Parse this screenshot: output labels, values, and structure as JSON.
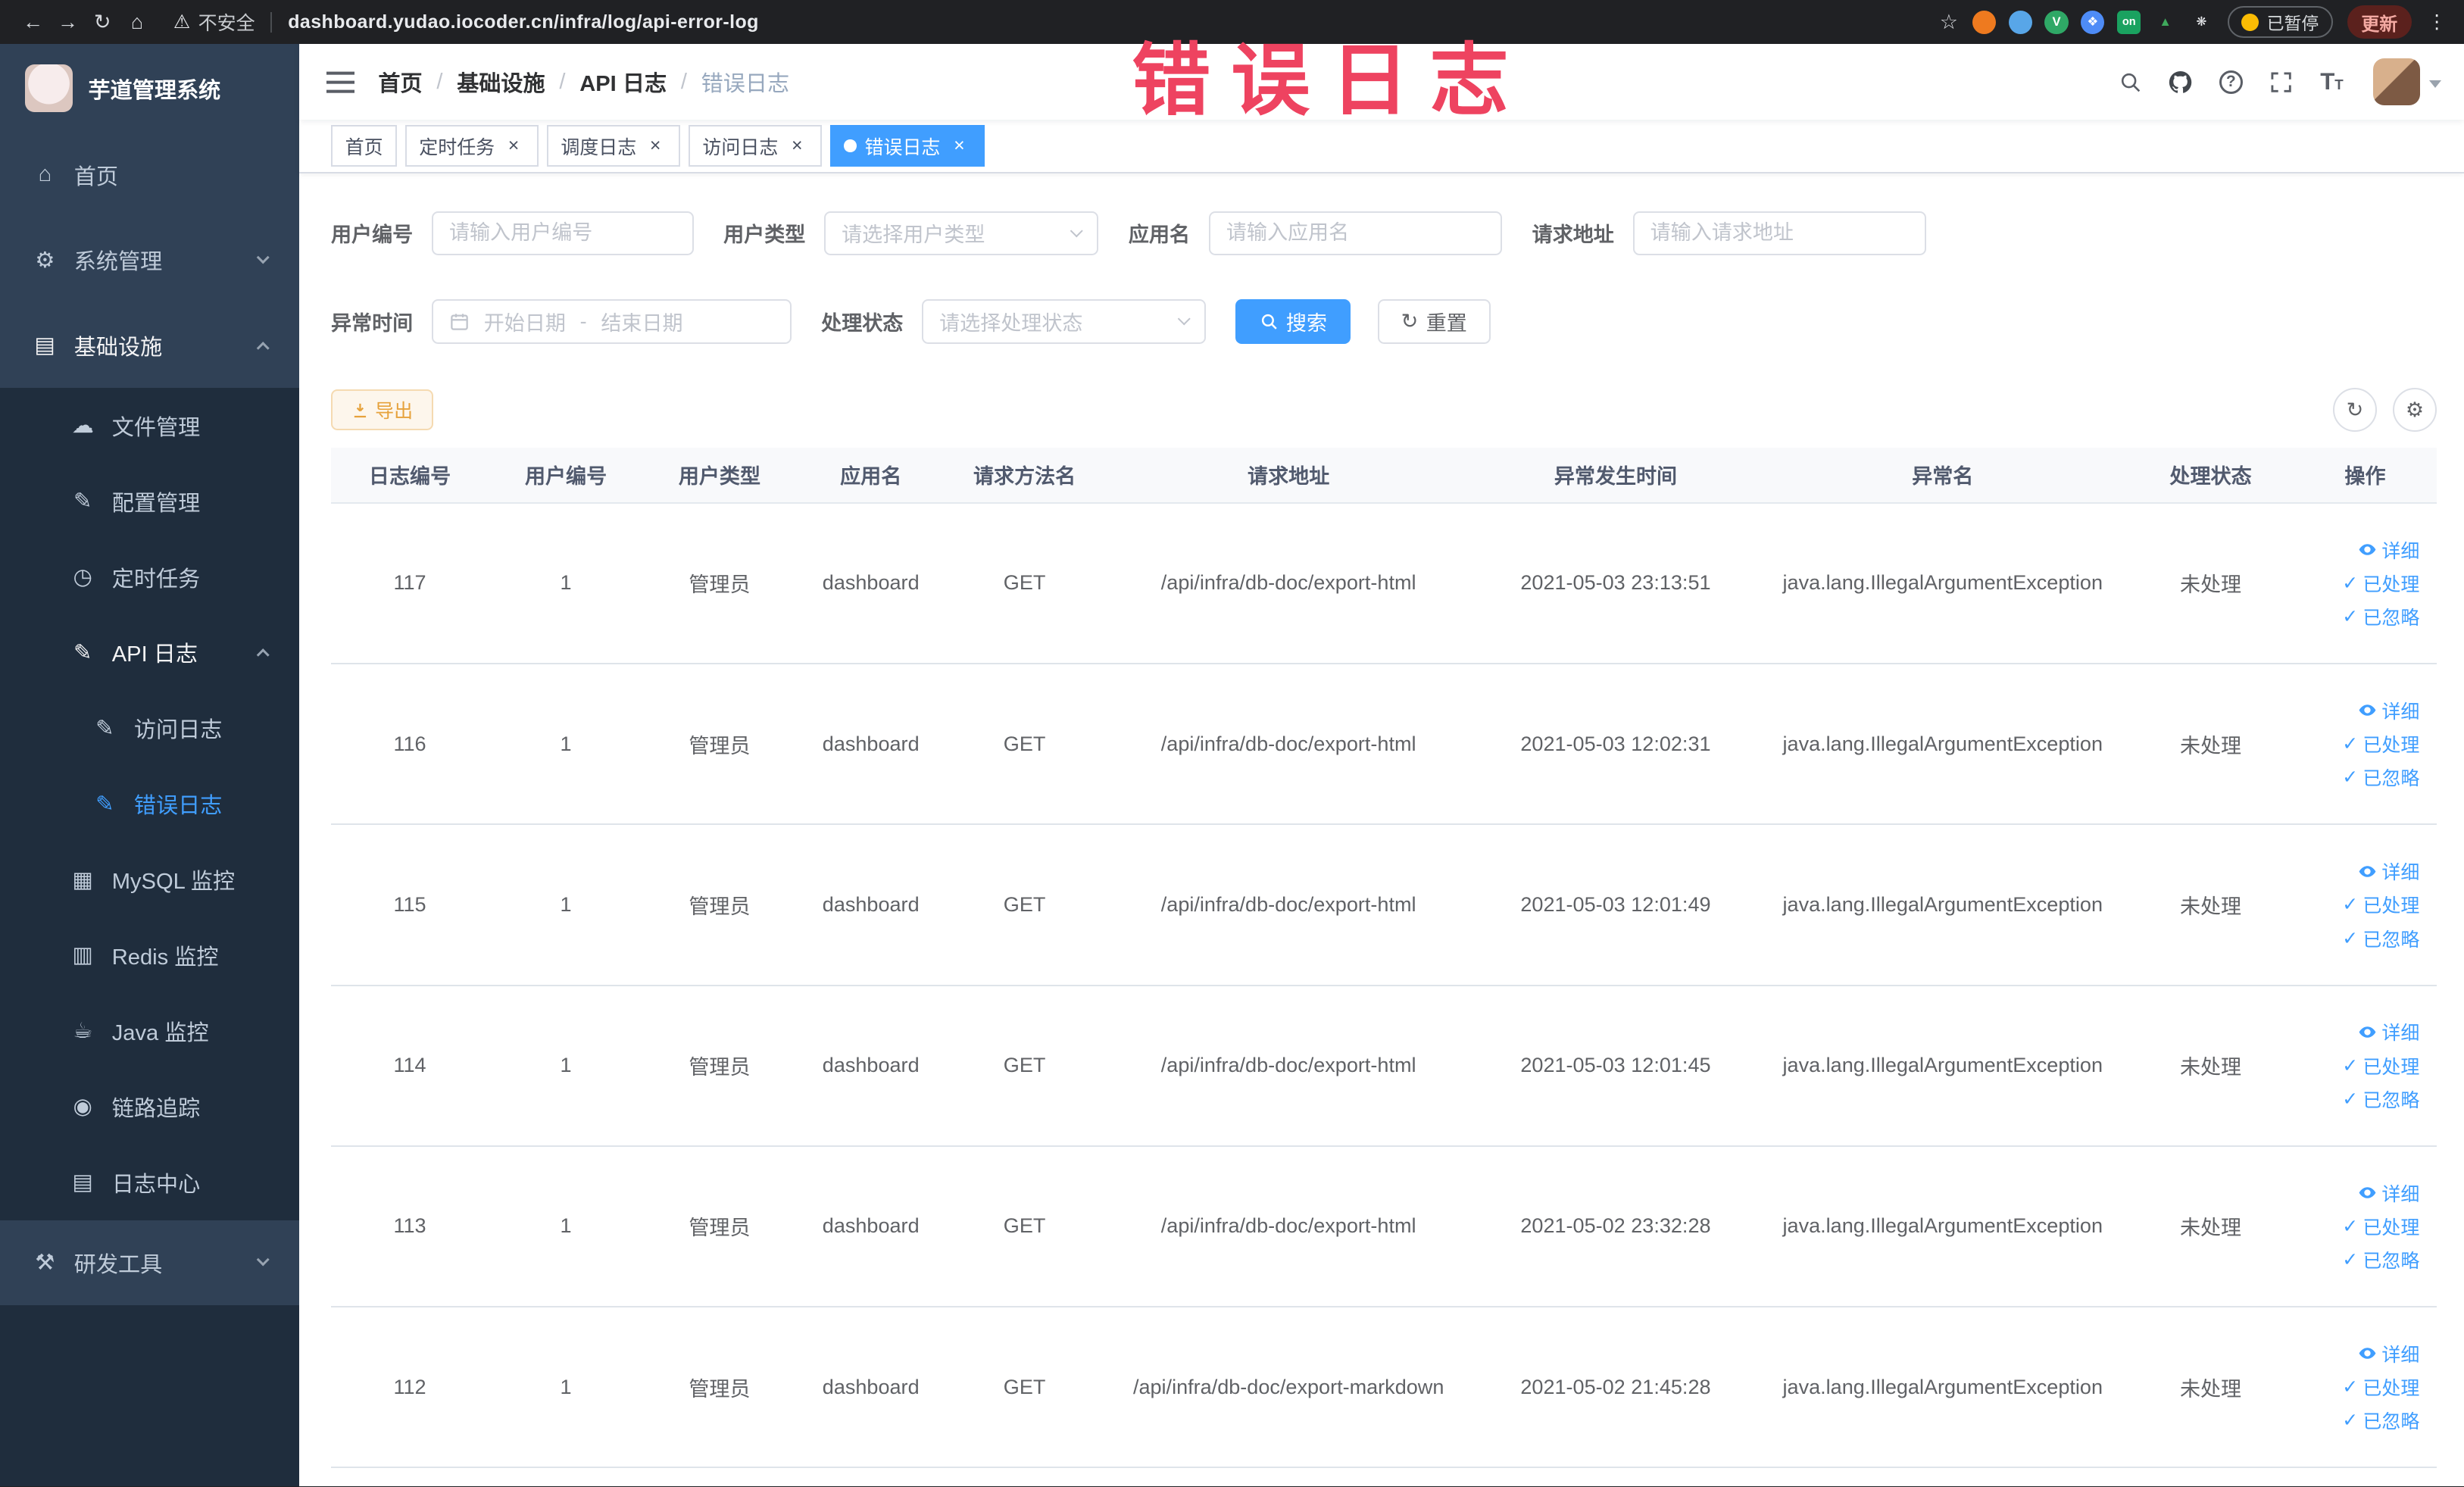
{
  "watermark": {
    "text": "错误日志"
  },
  "browser": {
    "security_label": "不安全",
    "url": "dashboard.yudao.iocoder.cn/infra/log/api-error-log",
    "paused_label": "已暂停",
    "update_label": "更新",
    "nav": {
      "back": "←",
      "forward": "→",
      "reload": "↻",
      "home": "⌂",
      "warning": "⚠",
      "star": "☆",
      "kebab": "⋮"
    },
    "extensions": [
      {
        "name": "extension-orange-icon",
        "color": "#ee7a1f",
        "glyph": "",
        "glyph_color": "#ffffff"
      },
      {
        "name": "extension-blue-icon",
        "color": "#58a6e8",
        "glyph": "",
        "glyph_color": "#ffffff"
      },
      {
        "name": "extension-green-v-icon",
        "color": "#2fa866",
        "glyph": "V",
        "glyph_color": "#ffffff"
      },
      {
        "name": "extension-blue-grid-icon",
        "color": "#4e8cf7",
        "glyph": "❖",
        "glyph_color": "#ffffff"
      },
      {
        "name": "extension-on-badge-icon",
        "color": "#1aa260",
        "glyph": "on",
        "glyph_color": "#ffffff"
      },
      {
        "name": "extension-tree-icon",
        "color": "transparent",
        "glyph": "▲",
        "glyph_color": "#3fa95c"
      },
      {
        "name": "extension-paw-icon",
        "color": "transparent",
        "glyph": "❋",
        "glyph_color": "#e8eaed"
      }
    ]
  },
  "sidebar": {
    "title": "芋道管理系统",
    "items": [
      {
        "key": "home",
        "label": "首页",
        "icon": "⌂",
        "type": "top"
      },
      {
        "key": "system",
        "label": "系统管理",
        "icon": "⚙",
        "type": "top",
        "chevron": "down"
      },
      {
        "key": "infra",
        "label": "基础设施",
        "icon": "▤",
        "type": "top",
        "chevron": "up",
        "parent": true
      },
      {
        "key": "file",
        "label": "文件管理",
        "icon": "☁",
        "type": "sub"
      },
      {
        "key": "config",
        "label": "配置管理",
        "icon": "✎",
        "type": "sub"
      },
      {
        "key": "job",
        "label": "定时任务",
        "icon": "◷",
        "type": "sub"
      },
      {
        "key": "api-log",
        "label": "API 日志",
        "icon": "✎",
        "type": "sub",
        "chevron": "up",
        "parent": true
      },
      {
        "key": "access-log",
        "label": "访问日志",
        "icon": "✎",
        "type": "sub2"
      },
      {
        "key": "error-log",
        "label": "错误日志",
        "icon": "✎",
        "type": "sub2",
        "active": true
      },
      {
        "key": "mysql",
        "label": "MySQL 监控",
        "icon": "▦",
        "type": "sub"
      },
      {
        "key": "redis",
        "label": "Redis 监控",
        "icon": "▥",
        "type": "sub"
      },
      {
        "key": "java",
        "label": "Java 监控",
        "icon": "☕",
        "type": "sub"
      },
      {
        "key": "trace",
        "label": "链路追踪",
        "icon": "◉",
        "type": "sub"
      },
      {
        "key": "log-center",
        "label": "日志中心",
        "icon": "▤",
        "type": "sub"
      },
      {
        "key": "devtools",
        "label": "研发工具",
        "icon": "⚒",
        "type": "top",
        "chevron": "down"
      }
    ]
  },
  "navbar": {
    "breadcrumb": [
      "首页",
      "基础设施",
      "API 日志",
      "错误日志"
    ],
    "separator": "/",
    "help_glyph": "?"
  },
  "tabs": [
    {
      "label": "首页",
      "closable": false,
      "active": false
    },
    {
      "label": "定时任务",
      "closable": true,
      "active": false
    },
    {
      "label": "调度日志",
      "closable": true,
      "active": false
    },
    {
      "label": "访问日志",
      "closable": true,
      "active": false
    },
    {
      "label": "错误日志",
      "closable": true,
      "active": true
    }
  ],
  "filters": {
    "user_id": {
      "label": "用户编号",
      "placeholder": "请输入用户编号"
    },
    "user_type": {
      "label": "用户类型",
      "placeholder": "请选择用户类型"
    },
    "app_name": {
      "label": "应用名",
      "placeholder": "请输入应用名"
    },
    "request_url": {
      "label": "请求地址",
      "placeholder": "请输入请求地址"
    },
    "exception_time": {
      "label": "异常时间",
      "start_placeholder": "开始日期",
      "separator": "-",
      "end_placeholder": "结束日期"
    },
    "process_status": {
      "label": "处理状态",
      "placeholder": "请选择处理状态"
    },
    "search_label": "搜索",
    "reset_label": "重置"
  },
  "toolbar": {
    "export_label": "导出"
  },
  "table": {
    "columns": [
      "日志编号",
      "用户编号",
      "用户类型",
      "应用名",
      "请求方法名",
      "请求地址",
      "异常发生时间",
      "异常名",
      "处理状态",
      "操作"
    ],
    "actions": [
      "详细",
      "已处理",
      "已忽略"
    ],
    "rows": [
      {
        "id": "117",
        "user_id": "1",
        "user_type": "管理员",
        "app": "dashboard",
        "method": "GET",
        "url": "/api/infra/db-doc/export-html",
        "time": "2021-05-03 23:13:51",
        "exception": "java.lang.IllegalArgumentException",
        "status": "未处理"
      },
      {
        "id": "116",
        "user_id": "1",
        "user_type": "管理员",
        "app": "dashboard",
        "method": "GET",
        "url": "/api/infra/db-doc/export-html",
        "time": "2021-05-03 12:02:31",
        "exception": "java.lang.IllegalArgumentException",
        "status": "未处理"
      },
      {
        "id": "115",
        "user_id": "1",
        "user_type": "管理员",
        "app": "dashboard",
        "method": "GET",
        "url": "/api/infra/db-doc/export-html",
        "time": "2021-05-03 12:01:49",
        "exception": "java.lang.IllegalArgumentException",
        "status": "未处理"
      },
      {
        "id": "114",
        "user_id": "1",
        "user_type": "管理员",
        "app": "dashboard",
        "method": "GET",
        "url": "/api/infra/db-doc/export-html",
        "time": "2021-05-03 12:01:45",
        "exception": "java.lang.IllegalArgumentException",
        "status": "未处理"
      },
      {
        "id": "113",
        "user_id": "1",
        "user_type": "管理员",
        "app": "dashboard",
        "method": "GET",
        "url": "/api/infra/db-doc/export-html",
        "time": "2021-05-02 23:32:28",
        "exception": "java.lang.IllegalArgumentException",
        "status": "未处理"
      },
      {
        "id": "112",
        "user_id": "1",
        "user_type": "管理员",
        "app": "dashboard",
        "method": "GET",
        "url": "/api/infra/db-doc/export-markdown",
        "time": "2021-05-02 21:45:28",
        "exception": "java.lang.IllegalArgumentException",
        "status": "未处理"
      }
    ]
  }
}
